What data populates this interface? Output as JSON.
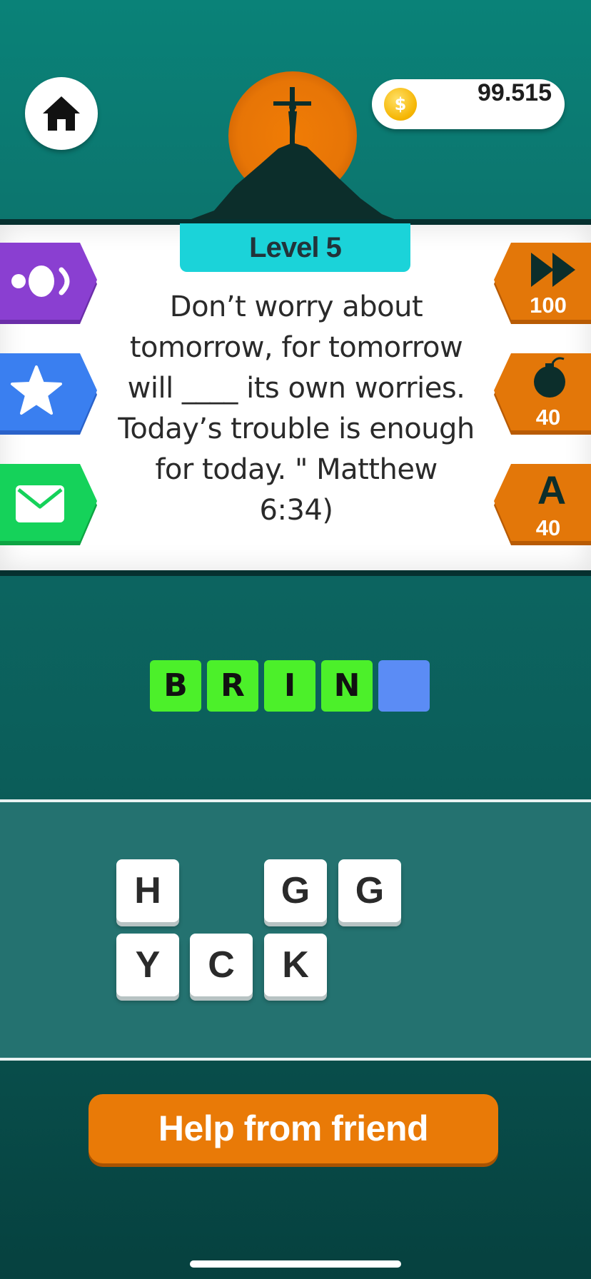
{
  "header": {
    "home_icon": "home-icon",
    "coins": "99.515",
    "coin_icon": "dollar-coin-icon",
    "coin_symbol": "$",
    "art": "crucifix-on-hill-with-sun"
  },
  "quote": {
    "level": "Level 5",
    "text": "Don’t worry about tomorrow, for tomorrow will ____ its own worries. Today’s trouble is enough for today. \" Matthew 6:34)"
  },
  "left_buttons": [
    {
      "icon": "speaker-icon",
      "color": "#8a3fd1"
    },
    {
      "icon": "star-icon",
      "color": "#3a7ff0"
    },
    {
      "icon": "mail-icon",
      "color": "#15d25a"
    }
  ],
  "right_buttons": [
    {
      "icon": "skip-forward-icon",
      "cost": "100",
      "color": "#e37709"
    },
    {
      "icon": "bomb-icon",
      "cost": "40",
      "color": "#e37709"
    },
    {
      "icon": "reveal-letter-icon",
      "glyph": "A",
      "cost": "40",
      "color": "#e37709"
    }
  ],
  "answer_tiles": [
    "B",
    "R",
    "I",
    "N",
    ""
  ],
  "letter_tiles": {
    "row1": [
      "H",
      "",
      "G",
      "G"
    ],
    "row2": [
      "Y",
      "C",
      "K"
    ]
  },
  "help_button": "Help from friend",
  "colors": {
    "accent_orange": "#e97a07",
    "answer_green": "#4cf02a",
    "answer_empty_blue": "#5b8cf5",
    "level_tab_cyan": "#1bd3d9"
  }
}
